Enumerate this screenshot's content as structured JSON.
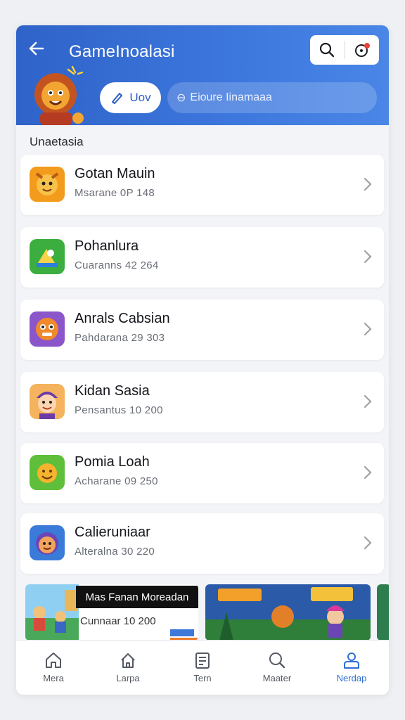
{
  "header": {
    "title": "GameInoalasi",
    "chip_label": "Uov",
    "search_text": "Eioure Iinamaaa"
  },
  "section": {
    "label": "Unaetasia"
  },
  "items": [
    {
      "name": "Gotan Mauin",
      "meta": "Msarane 0P 148",
      "icon": "lion-app-icon",
      "color": "#f39b1c"
    },
    {
      "name": "Pohanlura",
      "meta": "Cuaranns 42 264",
      "icon": "green-puzzle-icon",
      "color": "#3cae3f"
    },
    {
      "name": "Anrals Cabsian",
      "meta": "Pahdarana 29 303",
      "icon": "tiger-app-icon",
      "color": "#8a56c9"
    },
    {
      "name": "Kidan Sasia",
      "meta": "Pensantus 10 200",
      "icon": "kid-app-icon",
      "color": "#f4b35c"
    },
    {
      "name": "Pomia Loah",
      "meta": "Acharane 09 250",
      "icon": "smiley-app-icon",
      "color": "#5fbe3a"
    },
    {
      "name": "Calieruniaar",
      "meta": "Alteralna 30 220",
      "icon": "face-app-icon",
      "color": "#3a7ad8"
    }
  ],
  "banner": {
    "title": "Mas Fanan Moreadan",
    "sub": "Cunnaar 10 200"
  },
  "tabs": [
    {
      "label": "Mera",
      "icon": "home-icon"
    },
    {
      "label": "Larpa",
      "icon": "house-icon"
    },
    {
      "label": "Tern",
      "icon": "document-icon"
    },
    {
      "label": "Maater",
      "icon": "search-icon"
    },
    {
      "label": "Nerdap",
      "icon": "profile-icon",
      "active": true
    }
  ]
}
